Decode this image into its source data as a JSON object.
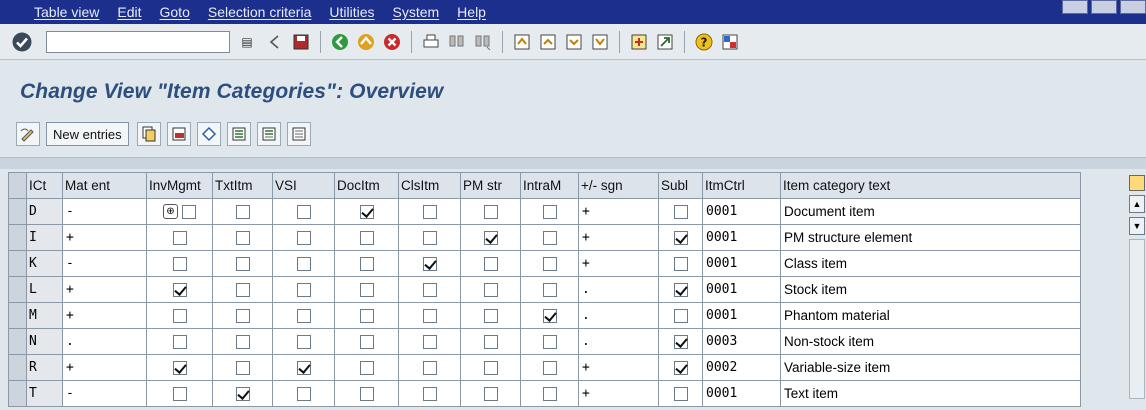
{
  "menu": [
    "Table view",
    "Edit",
    "Goto",
    "Selection criteria",
    "Utilities",
    "System",
    "Help"
  ],
  "command_field": {
    "value": ""
  },
  "page_title": "Change View \"Item Categories\": Overview",
  "appbar": {
    "new_entries_label": "New entries"
  },
  "table": {
    "columns": [
      "ICt",
      "Mat ent",
      "InvMgmt",
      "TxtItm",
      "VSI",
      "DocItm",
      "ClsItm",
      "PM str",
      "IntraM",
      "+/- sgn",
      "Subl",
      "ItmCtrl",
      "Item category text"
    ],
    "rows": [
      {
        "ict": "D",
        "mat_ent": "-",
        "invmgmt": false,
        "txtitm": false,
        "vsi": false,
        "docitm": true,
        "clsitm": false,
        "pmstr": false,
        "intram": false,
        "sgn": "+",
        "subl": false,
        "itmctrl": "0001",
        "text": "Document item"
      },
      {
        "ict": "I",
        "mat_ent": "+",
        "invmgmt": false,
        "txtitm": false,
        "vsi": false,
        "docitm": false,
        "clsitm": false,
        "pmstr": true,
        "intram": false,
        "sgn": "+",
        "subl": true,
        "itmctrl": "0001",
        "text": "PM structure element"
      },
      {
        "ict": "K",
        "mat_ent": "-",
        "invmgmt": false,
        "txtitm": false,
        "vsi": false,
        "docitm": false,
        "clsitm": true,
        "pmstr": false,
        "intram": false,
        "sgn": "+",
        "subl": false,
        "itmctrl": "0001",
        "text": "Class item"
      },
      {
        "ict": "L",
        "mat_ent": "+",
        "invmgmt": true,
        "txtitm": false,
        "vsi": false,
        "docitm": false,
        "clsitm": false,
        "pmstr": false,
        "intram": false,
        "sgn": ".",
        "subl": true,
        "itmctrl": "0001",
        "text": "Stock item"
      },
      {
        "ict": "M",
        "mat_ent": "+",
        "invmgmt": false,
        "txtitm": false,
        "vsi": false,
        "docitm": false,
        "clsitm": false,
        "pmstr": false,
        "intram": true,
        "sgn": ".",
        "subl": false,
        "itmctrl": "0001",
        "text": "Phantom material"
      },
      {
        "ict": "N",
        "mat_ent": ".",
        "invmgmt": false,
        "txtitm": false,
        "vsi": false,
        "docitm": false,
        "clsitm": false,
        "pmstr": false,
        "intram": false,
        "sgn": ".",
        "subl": true,
        "itmctrl": "0003",
        "text": "Non-stock item"
      },
      {
        "ict": "R",
        "mat_ent": "+",
        "invmgmt": true,
        "txtitm": false,
        "vsi": true,
        "docitm": false,
        "clsitm": false,
        "pmstr": false,
        "intram": false,
        "sgn": "+",
        "subl": true,
        "itmctrl": "0002",
        "text": "Variable-size item"
      },
      {
        "ict": "T",
        "mat_ent": "-",
        "invmgmt": false,
        "txtitm": true,
        "vsi": false,
        "docitm": false,
        "clsitm": false,
        "pmstr": false,
        "intram": false,
        "sgn": "+",
        "subl": false,
        "itmctrl": "0001",
        "text": "Text item"
      }
    ]
  },
  "colors": {
    "menubar": "#1c2f8c",
    "title": "#2d4f7e",
    "background": "#dfe6ec"
  }
}
